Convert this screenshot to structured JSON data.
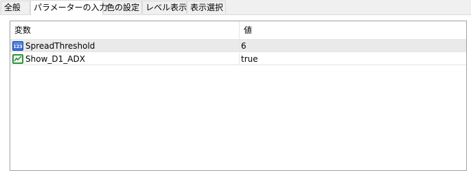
{
  "tabs": [
    {
      "label": "全般",
      "active": false
    },
    {
      "label": "パラメーターの入力",
      "active": true
    },
    {
      "label": "色の設定",
      "active": false
    },
    {
      "label": "レベル表示",
      "active": false
    },
    {
      "label": "表示選択",
      "active": false
    }
  ],
  "table": {
    "columns": [
      "変数",
      "値"
    ],
    "rows": [
      {
        "icon": "integer-123-icon",
        "icon_text": "123",
        "name": "SpreadThreshold",
        "value": "6",
        "selected": true
      },
      {
        "icon": "chart-bool-icon",
        "name": "Show_D1_ADX",
        "value": "true",
        "selected": false
      }
    ]
  },
  "colors": {
    "background": "#f0f0f0",
    "panel": "#ffffff",
    "selected_row": "#eaeaea",
    "border": "#a0a0a0"
  }
}
